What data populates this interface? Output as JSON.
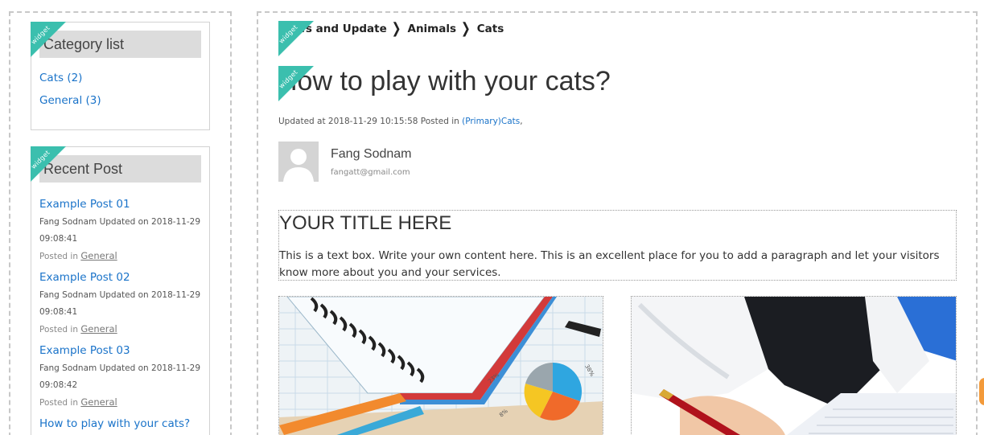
{
  "sidebar": {
    "category_widget": {
      "ribbon": "widget",
      "title": "Category list",
      "items": [
        {
          "label": "Cats (2)"
        },
        {
          "label": "General (3)"
        }
      ]
    },
    "recent_widget": {
      "ribbon": "widget",
      "title": "Recent Post",
      "posts": [
        {
          "title": "Example Post 01",
          "meta": "Fang Sodnam Updated on 2018-11-29 09:08:41",
          "posted_in": "Posted in",
          "category": "General"
        },
        {
          "title": "Example Post 02",
          "meta": "Fang Sodnam Updated on 2018-11-29 09:08:41",
          "posted_in": "Posted in",
          "category": "General"
        },
        {
          "title": "Example Post 03",
          "meta": "Fang Sodnam Updated on 2018-11-29 09:08:42",
          "posted_in": "Posted in",
          "category": "General"
        },
        {
          "title": "How to play with your cats?"
        }
      ]
    }
  },
  "main": {
    "breadcrumb": [
      "News and Update",
      "Animals",
      "Cats"
    ],
    "breadcrumb_ribbon": "widget",
    "title_ribbon": "widget",
    "title": "How to play with your cats?",
    "meta_prefix": "Updated at 2018-11-29 10:15:58 Posted in ",
    "meta_category": "(Primary)Cats",
    "meta_suffix": ",",
    "author": {
      "name": "Fang Sodnam",
      "email": "fangatt@gmail.com"
    },
    "textbox": {
      "title": "YOUR TITLE HERE",
      "body": "This is a text box. Write your own content here. This is an excellent place for you to add a paragraph and let your visitors know more about you and your services."
    }
  },
  "chart_labels": [
    "23%",
    "38%",
    "8%"
  ],
  "colors": {
    "accent": "#3bbfae",
    "link": "#1a73c9"
  }
}
